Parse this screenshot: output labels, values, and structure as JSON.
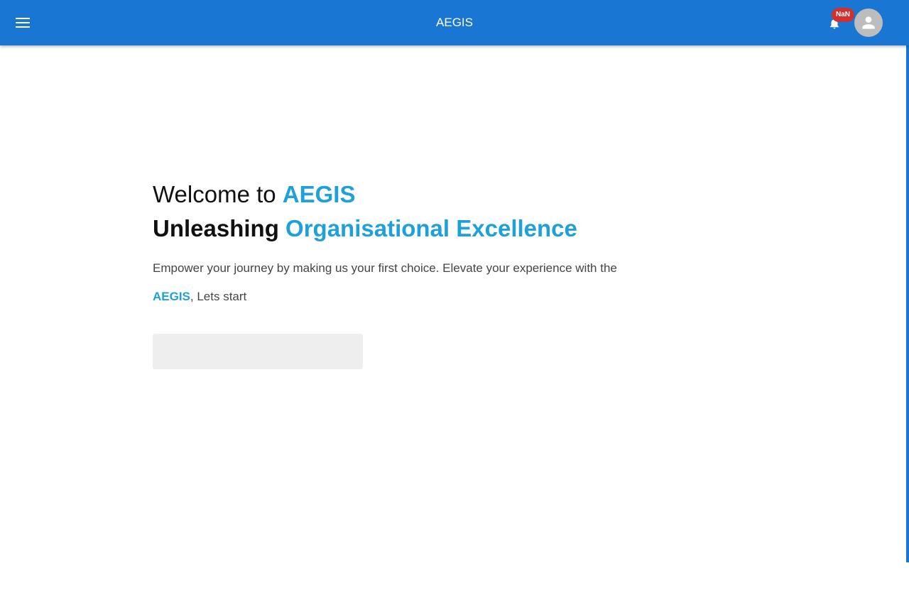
{
  "appbar": {
    "title": "AEGIS",
    "menu_icon": "menu-icon",
    "notifications_icon": "bell-icon",
    "notifications_badge": "NaN",
    "avatar_icon": "person-icon",
    "background_color": "#1976d2"
  },
  "hero": {
    "welcome_prefix": "Welcome to ",
    "welcome_brand": "AEGIS",
    "tagline_prefix": "Unleashing ",
    "tagline_accent": "Organisational Excellence",
    "description_prefix": "Empower your journey by making us your first choice. Elevate your experience with the ",
    "description_brand": "AEGIS",
    "description_suffix": ", Lets start",
    "start_button_label": "",
    "accent_color": "#1ea0dc"
  }
}
